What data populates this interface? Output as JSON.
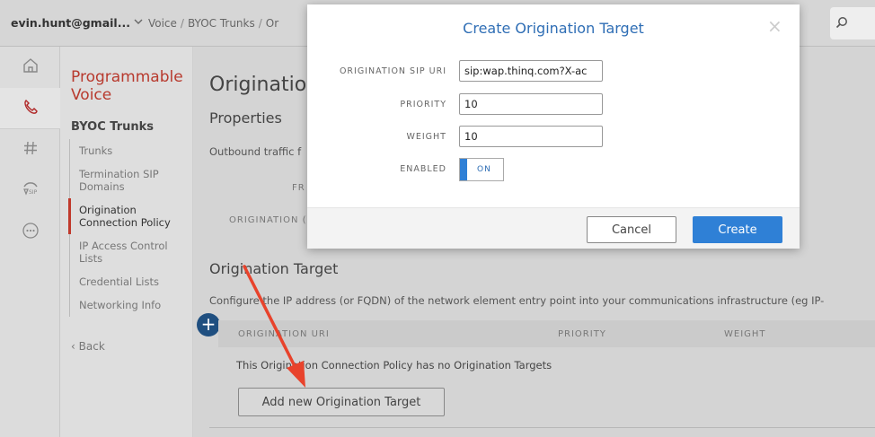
{
  "topbar": {
    "account": "evin.hunt@gmail...",
    "breadcrumbs": [
      "Voice",
      "BYOC Trunks",
      "Or"
    ]
  },
  "sidebar": {
    "title": "Programmable Voice",
    "section": "BYOC Trunks",
    "items": [
      {
        "label": "Trunks"
      },
      {
        "label": "Termination SIP Domains"
      },
      {
        "label": "Origination Connection Policy"
      },
      {
        "label": "IP Access Control Lists"
      },
      {
        "label": "Credential Lists"
      },
      {
        "label": "Networking Info"
      }
    ],
    "back_label": "Back"
  },
  "main": {
    "heading": "Originatio",
    "properties_heading": "Properties",
    "outbound_text": "Outbound traffic f",
    "label_fr": "FR",
    "label_origination": "ORIGINATION (",
    "target_heading": "Origination Target",
    "target_description": "Configure the IP address (or FQDN) of the network element entry point into your communications infrastructure (eg IP-",
    "table_headers": [
      "ORIGINATION URI",
      "PRIORITY",
      "WEIGHT"
    ],
    "empty_message": "This Origination Connection Policy has no Origination Targets",
    "add_button": "Add new Origination Target"
  },
  "modal": {
    "title": "Create Origination Target",
    "fields": {
      "uri_label": "ORIGINATION SIP URI",
      "uri_value": "sip:wap.thinq.com?X-ac",
      "priority_label": "PRIORITY",
      "priority_value": "10",
      "weight_label": "WEIGHT",
      "weight_value": "10",
      "enabled_label": "ENABLED",
      "enabled_value": "ON"
    },
    "cancel_label": "Cancel",
    "create_label": "Create"
  },
  "colors": {
    "accent": "#2f80d6",
    "brand_red": "#b83a2e",
    "annotation_arrow": "#e8432c"
  }
}
